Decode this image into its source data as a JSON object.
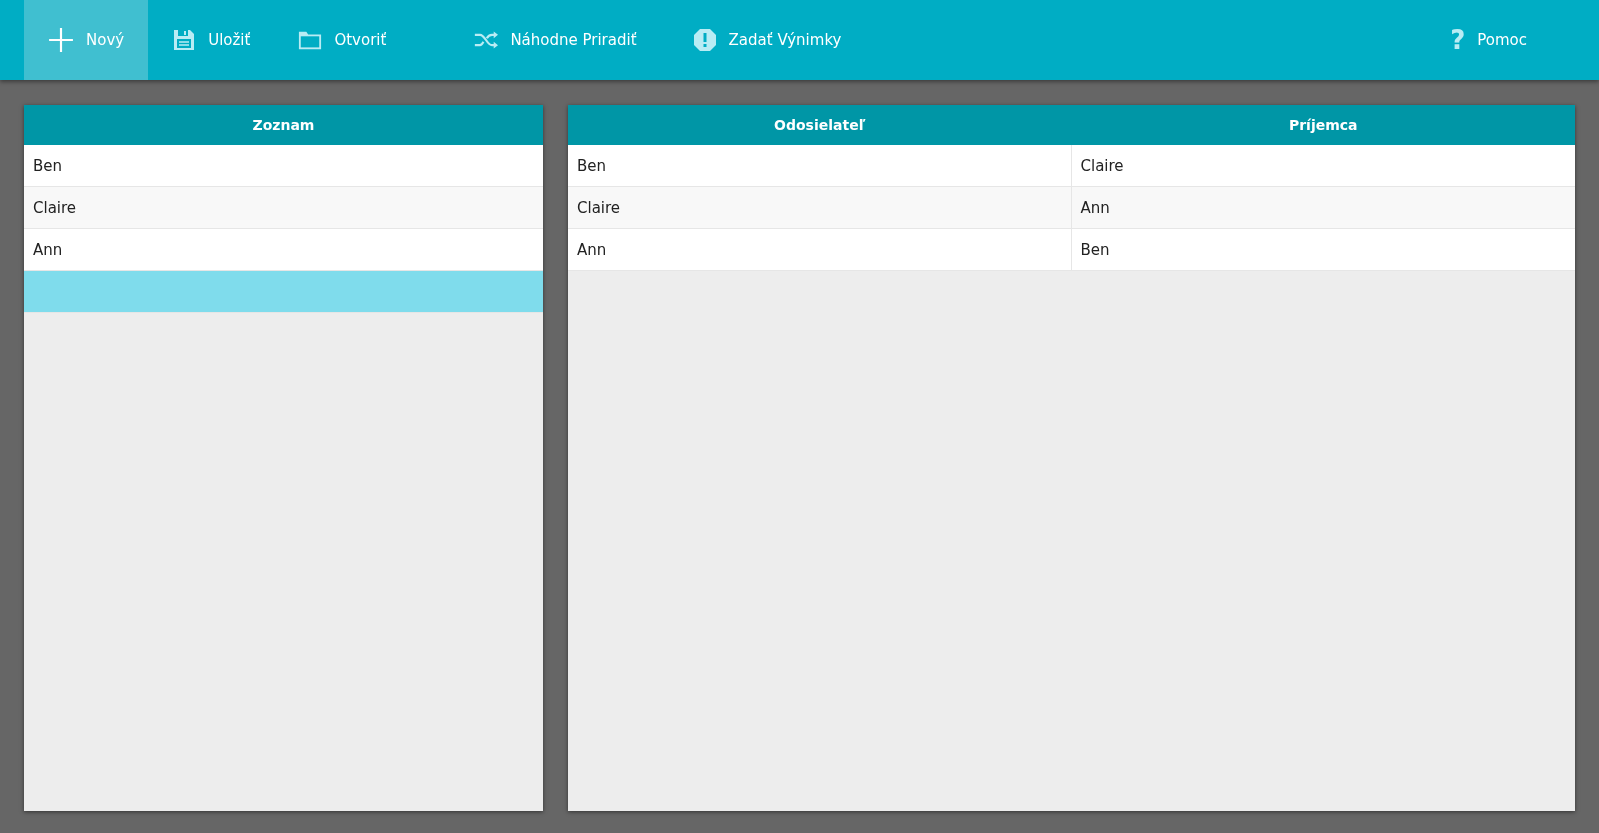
{
  "toolbar": {
    "items": [
      {
        "kind": "new",
        "label": "Nový",
        "selected": true
      },
      {
        "kind": "save",
        "label": "Uložiť",
        "selected": false
      },
      {
        "kind": "open",
        "label": "Otvoriť",
        "selected": false
      },
      {
        "kind": "shuffle",
        "label": "Náhodne Priradiť",
        "selected": false
      },
      {
        "kind": "exceptions",
        "label": "Zadať Výnimky",
        "selected": false
      }
    ],
    "help": {
      "glyph": "?",
      "label": "Pomoc"
    }
  },
  "list": {
    "title": "Zoznam",
    "rows": [
      {
        "name": "Ben",
        "selected": false
      },
      {
        "name": "Claire",
        "selected": false
      },
      {
        "name": "Ann",
        "selected": false
      }
    ],
    "new_row": {
      "selected": true
    }
  },
  "pairs": {
    "columns": [
      "Odosielateľ",
      "Príjemca"
    ],
    "rows": [
      [
        "Ben",
        "Claire"
      ],
      [
        "Claire",
        "Ann"
      ],
      [
        "Ann",
        "Ben"
      ]
    ]
  }
}
